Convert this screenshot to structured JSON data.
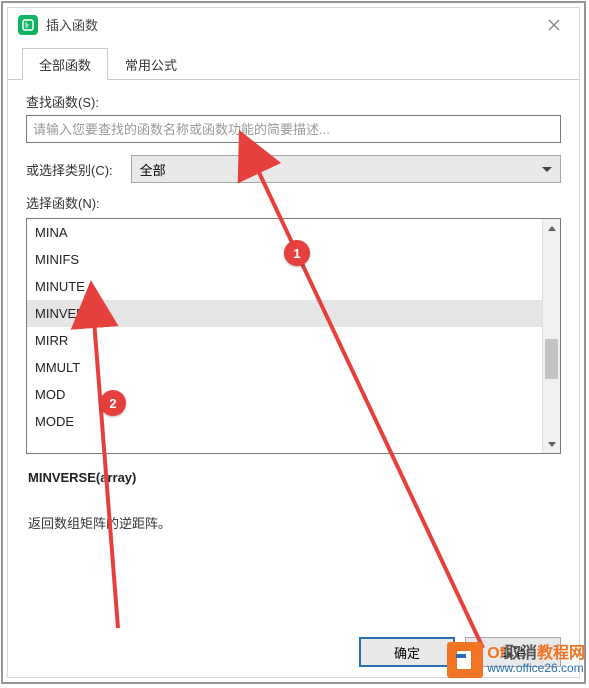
{
  "dialog": {
    "title": "插入函数"
  },
  "tabs": [
    {
      "label": "全部函数",
      "active": true
    },
    {
      "label": "常用公式",
      "active": false
    }
  ],
  "search": {
    "label": "查找函数(S):",
    "placeholder": "请输入您要查找的函数名称或函数功能的简要描述..."
  },
  "category": {
    "label": "或选择类别(C):",
    "value": "全部"
  },
  "functions": {
    "label": "选择函数(N):",
    "items": [
      "MINA",
      "MINIFS",
      "MINUTE",
      "MINVERSE",
      "MIRR",
      "MMULT",
      "MOD",
      "MODE"
    ],
    "selected_index": 3
  },
  "description": {
    "signature": "MINVERSE(array)",
    "text": "返回数组矩阵的逆距阵。"
  },
  "buttons": {
    "ok": "确定",
    "cancel": "取消"
  },
  "annotations": {
    "callout1": "1",
    "callout2": "2"
  },
  "watermark": {
    "brand_part1": "Of",
    "brand_part2": "教程网",
    "url": "www.office26.com"
  }
}
